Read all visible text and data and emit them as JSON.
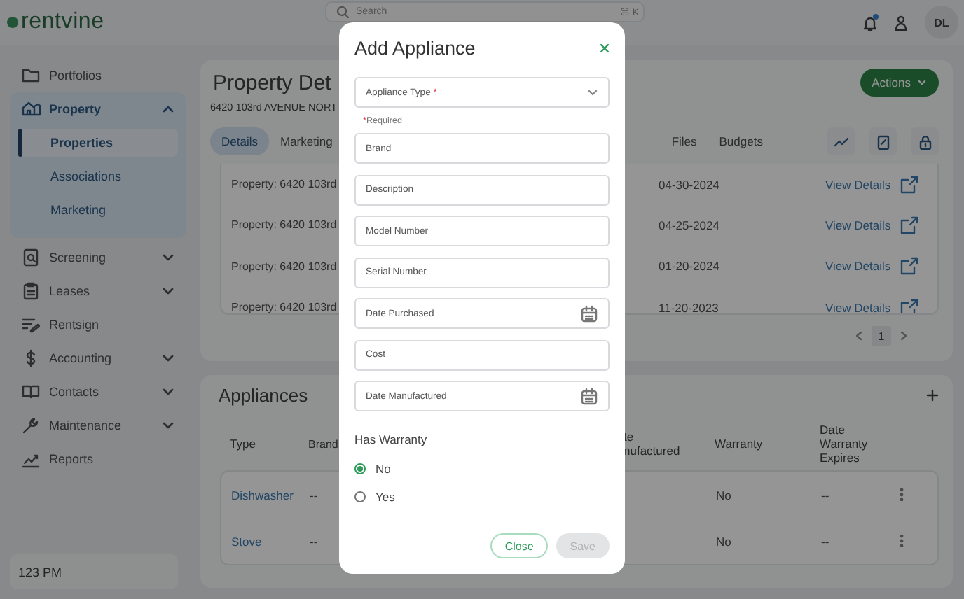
{
  "brand": {
    "name": "rentvine"
  },
  "search": {
    "placeholder": "Search",
    "shortcut": "⌘ K"
  },
  "notifications": {
    "unread": true
  },
  "user": {
    "initials": "DL"
  },
  "sidebar": {
    "items": [
      {
        "label": "Portfolios"
      },
      {
        "label": "Property",
        "expanded": true,
        "children": [
          {
            "label": "Properties",
            "selected": true
          },
          {
            "label": "Associations",
            "selected": false
          },
          {
            "label": "Marketing",
            "selected": false
          }
        ]
      },
      {
        "label": "Screening",
        "expanded": false
      },
      {
        "label": "Leases",
        "expanded": false
      },
      {
        "label": "Rentsign"
      },
      {
        "label": "Accounting",
        "expanded": false
      },
      {
        "label": "Contacts",
        "expanded": false
      },
      {
        "label": "Maintenance",
        "expanded": false
      },
      {
        "label": "Reports"
      }
    ]
  },
  "clock": "123 PM",
  "page": {
    "title": "Property Det",
    "address": "6420 103rd AVENUE NORT",
    "actions": "Actions",
    "tabs": [
      {
        "label": "Details",
        "selected": true
      },
      {
        "label": "Marketing",
        "selected": false
      },
      {
        "label": "Files",
        "selected": false
      },
      {
        "label": "Budgets",
        "selected": false
      }
    ],
    "records": [
      {
        "property": "Property: 6420 103rd",
        "date": "04-30-2024",
        "link": "View Details"
      },
      {
        "property": "Property: 6420 103rd",
        "date": "04-25-2024",
        "link": "View Details"
      },
      {
        "property": "Property: 6420 103rd",
        "date": "01-20-2024",
        "link": "View Details"
      },
      {
        "property": "Property: 6420 103rd",
        "date": "11-20-2023",
        "link": "View Details"
      }
    ],
    "pagination": {
      "current": "1"
    }
  },
  "appliances": {
    "title": "Appliances",
    "columns": [
      "Type",
      "Brand",
      "te nufactured",
      "Warranty",
      "Date Warranty Expires"
    ],
    "rows": [
      {
        "type": "Dishwasher",
        "brand": "--",
        "warranty": "No",
        "expires": "--"
      },
      {
        "type": "Stove",
        "brand": "--",
        "warranty": "No",
        "expires": "--"
      }
    ]
  },
  "modal": {
    "title": "Add Appliance",
    "fields": [
      {
        "kind": "select",
        "placeholder": "Appliance Type",
        "required_mark": "*",
        "helper_mark": "*",
        "helper": "Required"
      },
      {
        "kind": "text",
        "placeholder": "Brand"
      },
      {
        "kind": "text",
        "placeholder": "Description"
      },
      {
        "kind": "text",
        "placeholder": "Model Number"
      },
      {
        "kind": "text",
        "placeholder": "Serial Number"
      },
      {
        "kind": "date",
        "placeholder": "Date Purchased"
      },
      {
        "kind": "text",
        "placeholder": "Cost"
      },
      {
        "kind": "date",
        "placeholder": "Date Manufactured"
      }
    ],
    "warranty": {
      "label": "Has Warranty",
      "options": [
        {
          "label": "No",
          "selected": true
        },
        {
          "label": "Yes",
          "selected": false
        }
      ]
    },
    "buttons": [
      {
        "label": "Close",
        "kind": "outline",
        "disabled": false
      },
      {
        "label": "Save",
        "kind": "primary",
        "disabled": true
      }
    ]
  }
}
